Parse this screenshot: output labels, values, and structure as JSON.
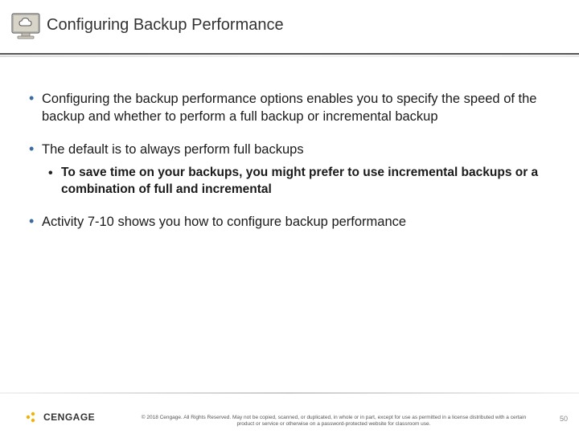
{
  "header": {
    "title": "Configuring Backup Performance"
  },
  "bullets": [
    {
      "text": "Configuring the backup performance options enables you to specify the speed of the backup and whether to perform a full backup or incremental backup",
      "sub": []
    },
    {
      "text": "The default is to always perform full backups",
      "sub": [
        "To save time on your backups, you might prefer to use incremental backups or a combination of full and incremental"
      ]
    },
    {
      "text": "Activity 7-10 shows you how to configure backup performance",
      "sub": []
    }
  ],
  "footer": {
    "brand": "CENGAGE",
    "copyright": "© 2018 Cengage. All Rights Reserved. May not be copied, scanned, or duplicated, in whole or in part, except for use as permitted in a license distributed with a certain product or service or otherwise on a password-protected website for classroom use.",
    "page": "50"
  }
}
